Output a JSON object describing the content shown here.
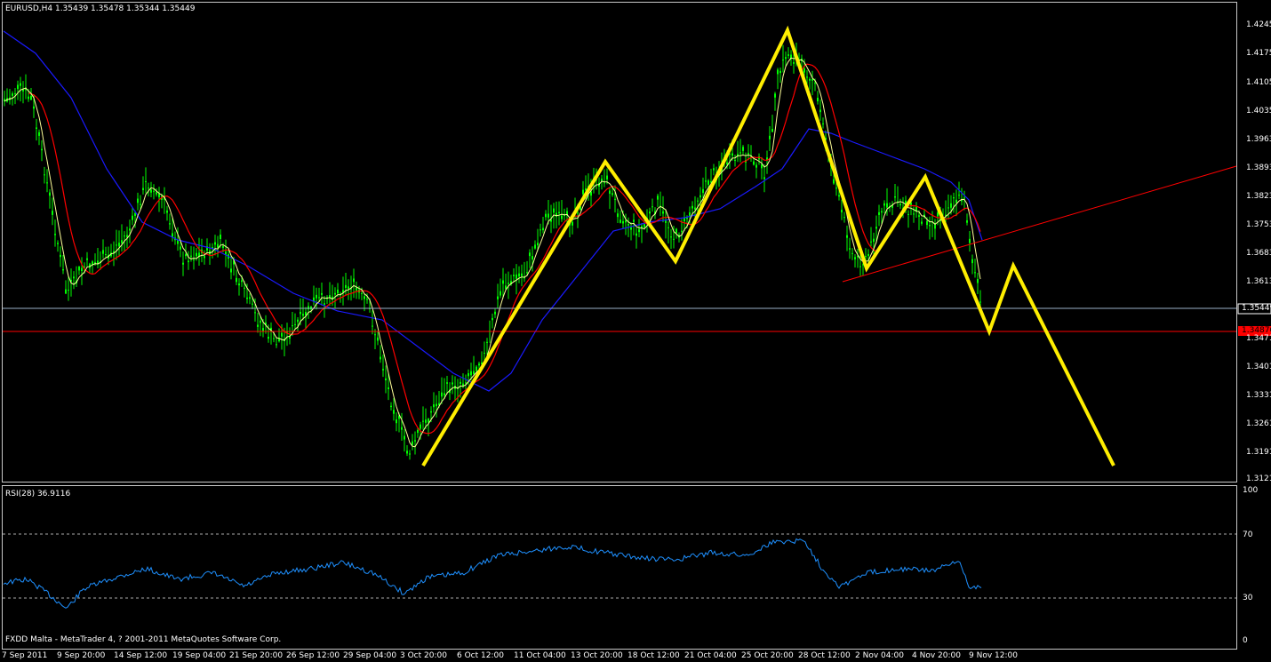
{
  "main_chart": {
    "title": "EURUSD,H4  1.35439 1.35478 1.35344 1.35449",
    "symbol": "EURUSD",
    "timeframe": "H4",
    "ohlc": {
      "open": 1.35439,
      "high": 1.35478,
      "low": 1.35344,
      "close": 1.35449
    },
    "price_labels": [
      "1.42450",
      "1.41750",
      "1.41050",
      "1.40350",
      "1.39630",
      "1.38930",
      "1.38230",
      "1.37530",
      "1.36830",
      "1.36130",
      "1.35449",
      "1.34876",
      "1.34710",
      "1.34010",
      "1.33310",
      "1.32610",
      "1.31910",
      "1.31210"
    ],
    "current_price_tag": "1.35449",
    "resistance_tag": "1.34876",
    "colors": {
      "candles": "#00ff00",
      "ma_fast": "#ffff99",
      "ma_mid": "#ff0000",
      "ma_slow": "#1a1aff",
      "pattern": "#ffee00",
      "trendline": "#ff0000",
      "bid_line": "#9ab0c8",
      "level_line": "#ff0000"
    }
  },
  "time_axis": {
    "labels": [
      "7 Sep 2011",
      "9 Sep 20:00",
      "14 Sep 12:00",
      "19 Sep 04:00",
      "21 Sep 20:00",
      "26 Sep 12:00",
      "29 Sep 04:00",
      "3 Oct 20:00",
      "6 Oct 12:00",
      "11 Oct 04:00",
      "13 Oct 20:00",
      "18 Oct 12:00",
      "21 Oct 04:00",
      "25 Oct 20:00",
      "28 Oct 12:00",
      "2 Nov 04:00",
      "4 Nov 20:00",
      "9 Nov 12:00"
    ]
  },
  "rsi_panel": {
    "title": "RSI(28) 36.9116",
    "period": 28,
    "value": 36.9116,
    "levels": [
      "100",
      "70",
      "30",
      "0"
    ],
    "line_color": "#1e90ff"
  },
  "footer": {
    "copyright": "FXDD Malta - MetaTrader 4, ? 2001-2011 MetaQuotes Software Corp."
  }
}
